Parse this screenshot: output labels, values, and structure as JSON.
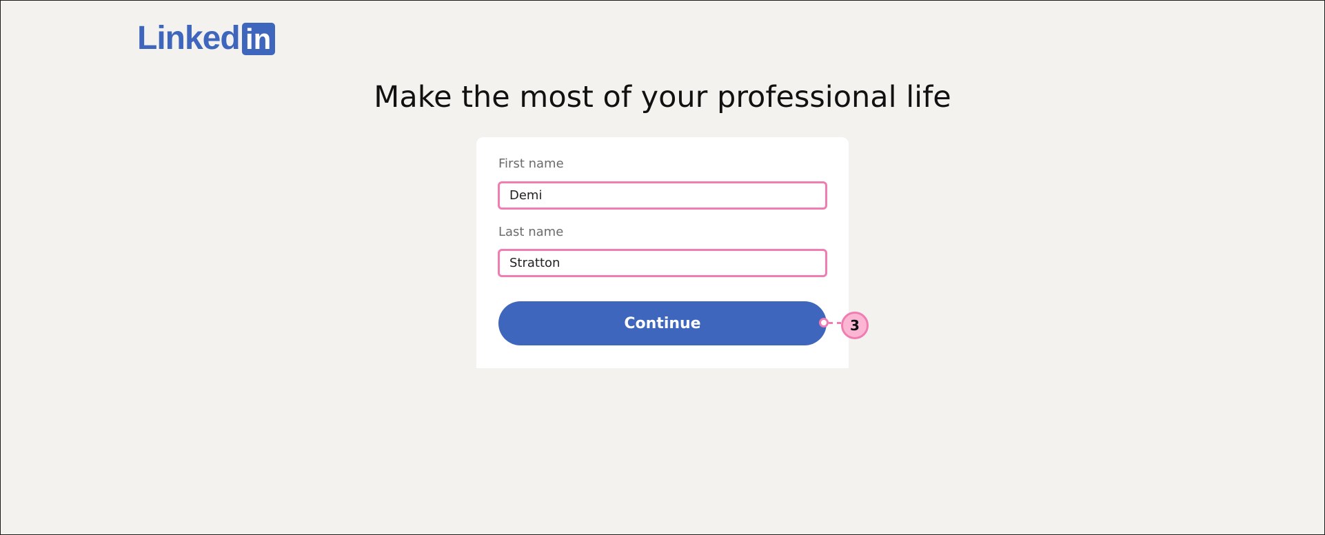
{
  "logo": {
    "text": "Linked",
    "box_text": "in",
    "brand_color": "#3d66bc"
  },
  "headline": "Make the most of your professional life",
  "form": {
    "first_name": {
      "label": "First name",
      "value": "Demi"
    },
    "last_name": {
      "label": "Last name",
      "value": "Stratton"
    },
    "continue_label": "Continue"
  },
  "annotation": {
    "number": "3",
    "color": "#f07cb1"
  }
}
